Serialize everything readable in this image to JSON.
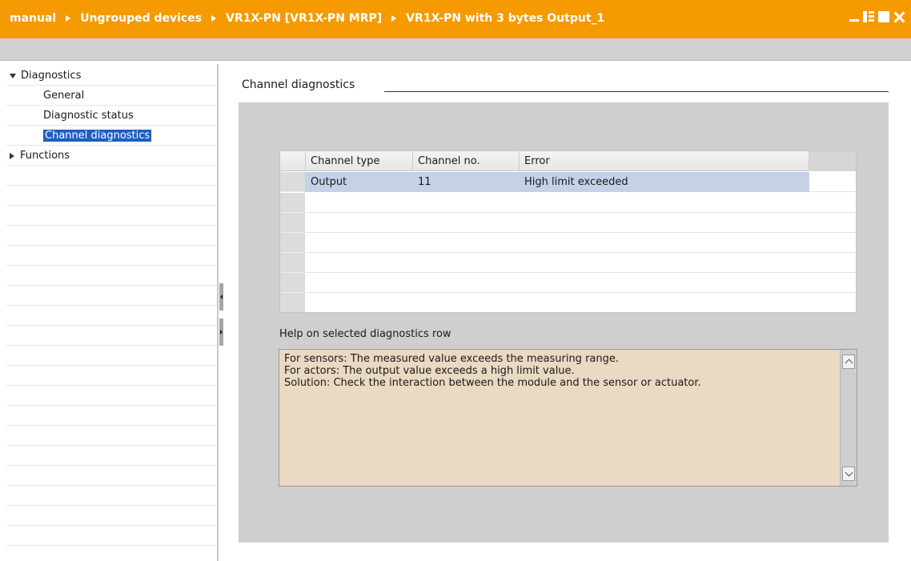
{
  "titlebar": {
    "breadcrumb": [
      "manual",
      "Ungrouped devices",
      "VR1X-PN [VR1X-PN MRP]",
      "VR1X-PN with 3 bytes Output_1"
    ],
    "accent_color": "#f59a00"
  },
  "tree": {
    "groups": [
      {
        "label": "Diagnostics",
        "expanded": true,
        "children": [
          "General",
          "Diagnostic status",
          "Channel diagnostics"
        ]
      },
      {
        "label": "Functions",
        "expanded": false
      }
    ],
    "selected": "Channel diagnostics"
  },
  "section": {
    "title": "Channel diagnostics"
  },
  "table": {
    "columns": [
      "Channel type",
      "Channel no.",
      "Error"
    ],
    "rows": [
      {
        "channel_type": "Output",
        "channel_no": "11",
        "error": "High limit exceeded"
      }
    ],
    "empty_rows": 6
  },
  "help": {
    "label": "Help on selected diagnostics row",
    "lines": [
      "For sensors: The measured value exceeds the measuring range.",
      "For actors: The output value exceeds a high limit value.",
      "Solution: Check the interaction between the module and the sensor or actuator."
    ],
    "background": "#ead9c3"
  },
  "icons": [
    "minimize-icon",
    "split-view-icon",
    "maximize-icon",
    "close-icon",
    "expand-arrow-icon",
    "collapse-arrow-icon",
    "scroll-up-icon",
    "scroll-down-icon"
  ]
}
